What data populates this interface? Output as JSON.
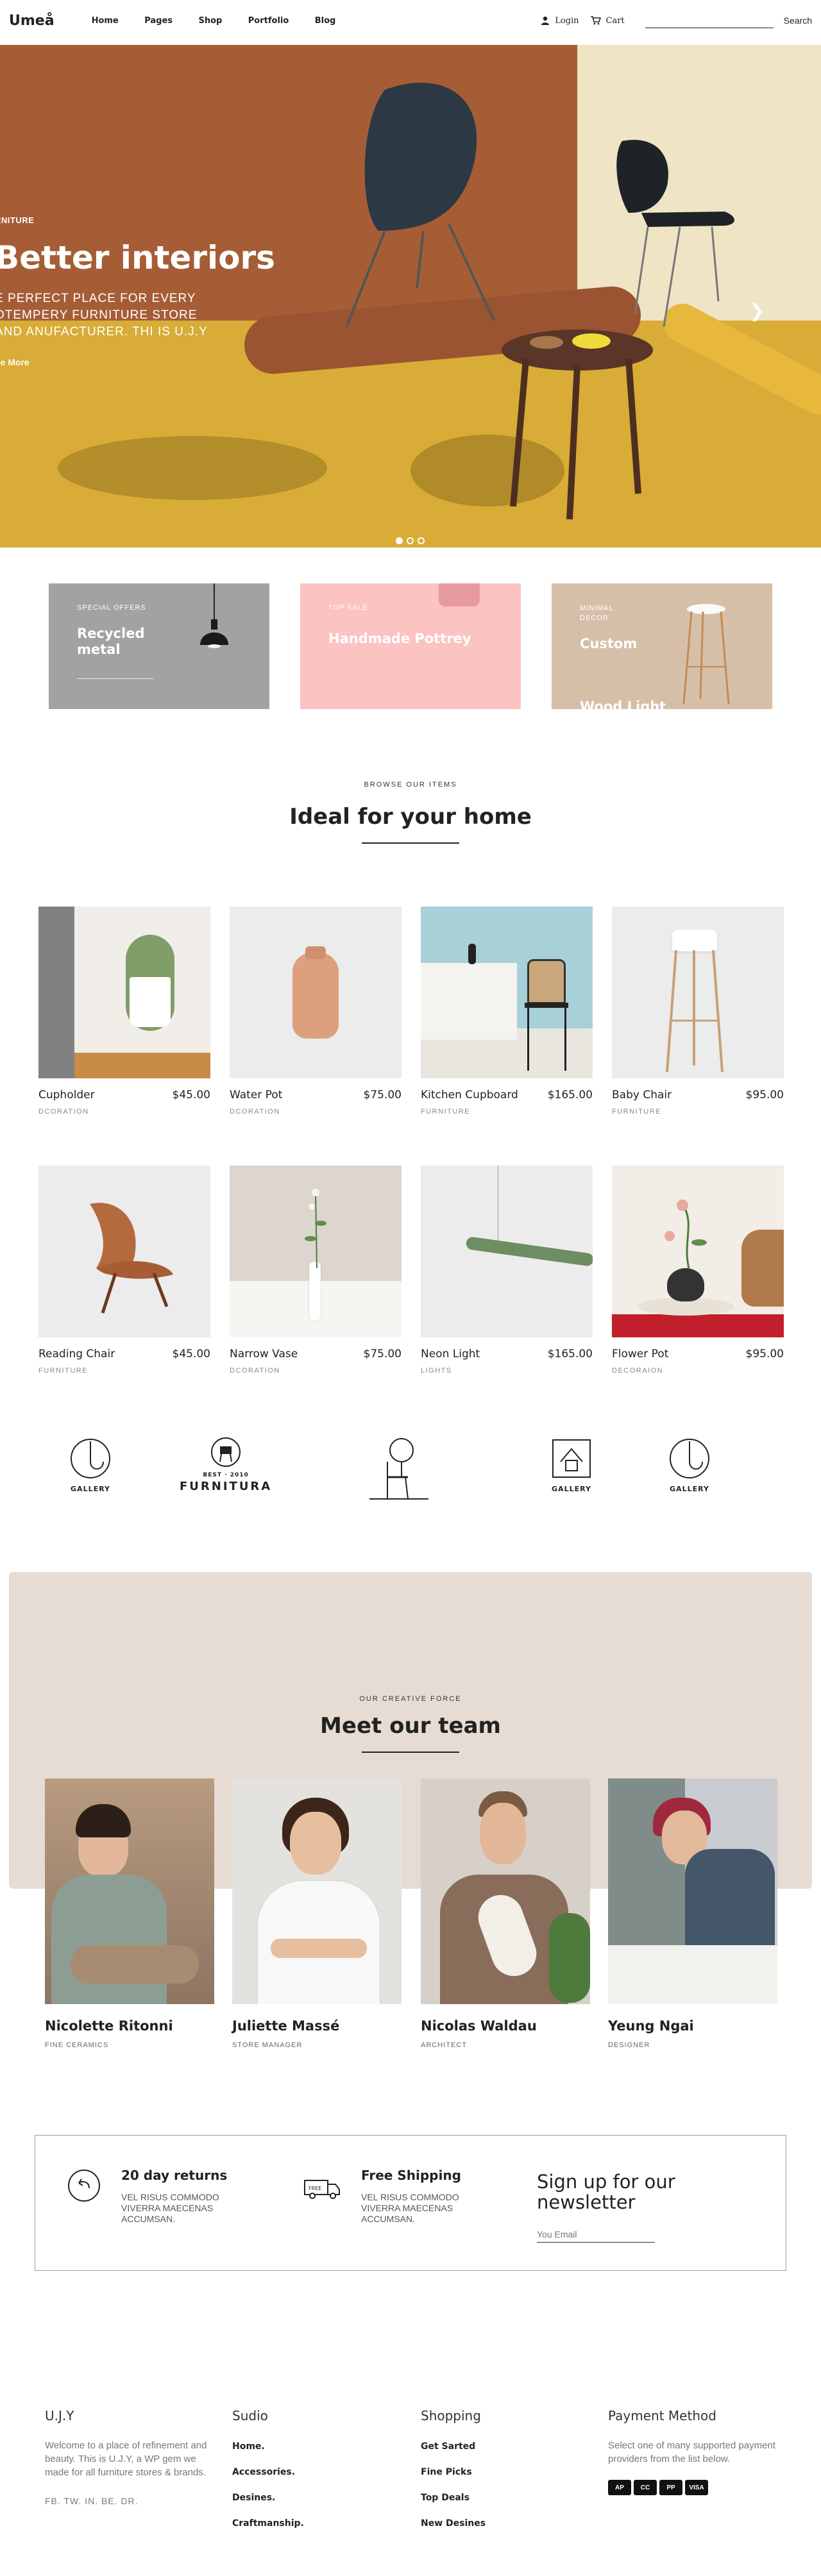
{
  "header": {
    "logo": "Umeå",
    "nav": [
      "Home",
      "Pages",
      "Shop",
      "Portfolio",
      "Blog"
    ],
    "login": "Login",
    "cart": "Cart",
    "search_placeholder": "",
    "search_button": "Search"
  },
  "hero": {
    "kicker": "RNITURE",
    "title": "Better interiors",
    "description": "E PERFECT PLACE FOR EVERY OTEMPERY FURNITURE STORE AND ANUFACTURER. THI IS U.J.Y",
    "link": "ne More"
  },
  "promos": [
    {
      "kicker": "SPECIAL OFFERS",
      "title": "Recycled metal",
      "color": "#a2a2a2"
    },
    {
      "kicker": "TOP SALE",
      "title": "Handmade Pottrey",
      "color": "#fcc3c3"
    },
    {
      "kicker": "MINIMAL DECOR",
      "title": "Custom",
      "extra": "Wood Light",
      "color": "#d6bfa8"
    }
  ],
  "browse": {
    "kicker": "BROWSE OUR ITEMS",
    "title": "Ideal for your home"
  },
  "products": [
    {
      "name": "Cupholder",
      "price": "$45.00",
      "category": "DCORATION"
    },
    {
      "name": "Water Pot",
      "price": "$75.00",
      "category": "DCORATION"
    },
    {
      "name": "Kitchen Cupboard",
      "price": "$165.00",
      "category": "FURNITURE"
    },
    {
      "name": "Baby Chair",
      "price": "$95.00",
      "category": "FURNITURE"
    },
    {
      "name": "Reading Chair",
      "price": "$45.00",
      "category": "FURNITURE"
    },
    {
      "name": "Narrow Vase",
      "price": "$75.00",
      "category": "DCORATION"
    },
    {
      "name": "Neon Light",
      "price": "$165.00",
      "category": "LIGHTS"
    },
    {
      "name": "Flower Pot",
      "price": "$95.00",
      "category": "DECORAION"
    }
  ],
  "brands": [
    {
      "name": "GALLERY"
    },
    {
      "name": "FURNITURA",
      "sub": "BEST · 2010"
    },
    {
      "name": ""
    },
    {
      "name": "GALLERY"
    },
    {
      "name": "GALLERY"
    }
  ],
  "team": {
    "kicker": "OUR CREATIVE FORCE",
    "title": "Meet our team",
    "members": [
      {
        "name": "Nicolette Ritonni",
        "role": "FINE CERAMICS"
      },
      {
        "name": "Juliette Massé",
        "role": "STORE MANAGER"
      },
      {
        "name": "Nicolas Waldau",
        "role": "ARCHITECT"
      },
      {
        "name": "Yeung Ngai",
        "role": "DESIGNER"
      }
    ]
  },
  "features": [
    {
      "icon": "return-icon",
      "title": "20 day returns",
      "desc": "VEL RISUS COMMODO VIVERRA MAECENAS ACCUMSAN."
    },
    {
      "icon": "truck-icon",
      "title": "Free Shipping",
      "desc": "VEL RISUS COMMODO VIVERRA MAECENAS ACCUMSAN."
    }
  ],
  "newsletter": {
    "title": "Sign up for our newsletter",
    "placeholder": "You Email"
  },
  "footer": {
    "about_title": "U.J.Y",
    "about_text": "Welcome to a place of refinement and beauty. This is U.J.Y, a WP gem we made for all furniture stores & brands.",
    "social": "FB. TW. IN. BE. DR.",
    "studio_title": "Sudio",
    "studio_links": [
      "Home.",
      "Accessories.",
      "Desines.",
      "Craftmanship."
    ],
    "shopping_title": "Shopping",
    "shopping_links": [
      "Get Sarted",
      "Fine Picks",
      "Top Deals",
      "New Desines"
    ],
    "payment_title": "Payment Method",
    "payment_text": "Select one of many supported payment providers from the list below.",
    "payment_icons": [
      "AP",
      "CC",
      "PP",
      "VISA"
    ]
  }
}
